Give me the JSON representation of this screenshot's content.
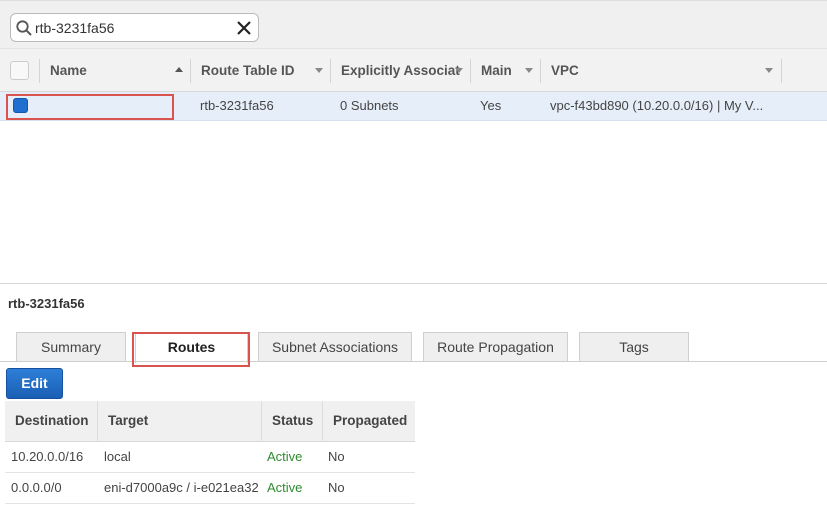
{
  "search": {
    "value": "rtb-3231fa56"
  },
  "table": {
    "columns": [
      "Name",
      "Route Table ID",
      "Explicitly Associat",
      "Main",
      "VPC"
    ],
    "rows": [
      {
        "name": "",
        "route_table_id": "rtb-3231fa56",
        "explicitly_associated": "0 Subnets",
        "main": "Yes",
        "vpc": "vpc-f43bd890 (10.20.0.0/16) | My V..."
      }
    ]
  },
  "details": {
    "title": "rtb-3231fa56",
    "tabs": [
      "Summary",
      "Routes",
      "Subnet Associations",
      "Route Propagation",
      "Tags"
    ],
    "active_tab": "Routes",
    "edit_label": "Edit"
  },
  "routes": {
    "columns": [
      "Destination",
      "Target",
      "Status",
      "Propagated"
    ],
    "rows": [
      {
        "destination": "10.20.0.0/16",
        "target": "local",
        "status": "Active",
        "propagated": "No"
      },
      {
        "destination": "0.0.0.0/0",
        "target": "eni-d7000a9c / i-e021ea32",
        "status": "Active",
        "propagated": "No"
      }
    ]
  },
  "colors": {
    "accent": "#1f6fd0",
    "highlight": "#d9534f",
    "status_active": "#2e8b2e",
    "selected_row": "#e6eff9"
  }
}
